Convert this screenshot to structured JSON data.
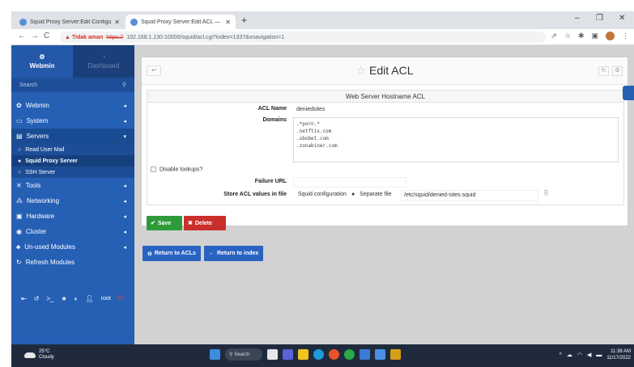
{
  "browser": {
    "tabs": [
      {
        "title": "Squid Proxy Server:Edit Configu...",
        "close": "✕"
      },
      {
        "title": "Squid Proxy Server:Edit ACL — ...",
        "close": "✕"
      }
    ],
    "new_tab": "+",
    "win_min": "–",
    "win_max": "❐",
    "win_close": "✕",
    "url_warning": "▲ Tidak aman",
    "url_scheme": "https://",
    "url_rest": "192.168.1.130:10000/squid/acl.cgi?index=1337&xnavigation=1"
  },
  "sidebar": {
    "brand_label": "Webmin",
    "dashboard_label": "Dashboard",
    "search_placeholder": "Search",
    "items": [
      {
        "label": "Webmin",
        "icon": "gear-icon"
      },
      {
        "label": "System",
        "icon": "monitor-icon"
      },
      {
        "label": "Servers",
        "icon": "server-icon"
      },
      {
        "label": "Tools",
        "icon": "tools-icon"
      },
      {
        "label": "Networking",
        "icon": "network-icon"
      },
      {
        "label": "Hardware",
        "icon": "hardware-icon"
      },
      {
        "label": "Cluster",
        "icon": "cluster-icon"
      },
      {
        "label": "Un-used Modules",
        "icon": "puzzle-icon"
      },
      {
        "label": "Refresh Modules",
        "icon": "refresh-icon"
      }
    ],
    "sub_items": [
      {
        "label": "Read User Mail"
      },
      {
        "label": "Squid Proxy Server"
      },
      {
        "label": "SSH Server"
      }
    ],
    "user": "root"
  },
  "panel": {
    "title": "Edit ACL",
    "section_title": "Web Server Hostname ACL",
    "acl_name_label": "ACL Name",
    "acl_name_value": "deniedsites",
    "domains_label": "Domains",
    "domains": [
      ".*porn.*",
      ".netflix.com",
      ".sbobet.com",
      ".zonabiner.com"
    ],
    "disable_lookups_label": "Disable lookups?",
    "failure_url_label": "Failure URL",
    "failure_url_value": "",
    "store_label": "Store ACL values in file",
    "store_opt1": "Squid configuration",
    "store_opt2": "Separate file",
    "store_file_path": "/etc/squid/denied-sites.squid"
  },
  "buttons": {
    "save": "Save",
    "delete": "Delete",
    "return_acls": "Return to ACLs",
    "return_index": "Return to index"
  },
  "taskbar": {
    "temp": "25°C",
    "weather": "Cloudy",
    "search": "Search",
    "time": "11:38 AM",
    "date": "11/17/2022"
  },
  "colors": {
    "sidebar": "#2560b5",
    "save": "#2e9b3b",
    "delete": "#c9302c",
    "action": "#2a62c2",
    "taskbar": "#1f2b3d"
  }
}
